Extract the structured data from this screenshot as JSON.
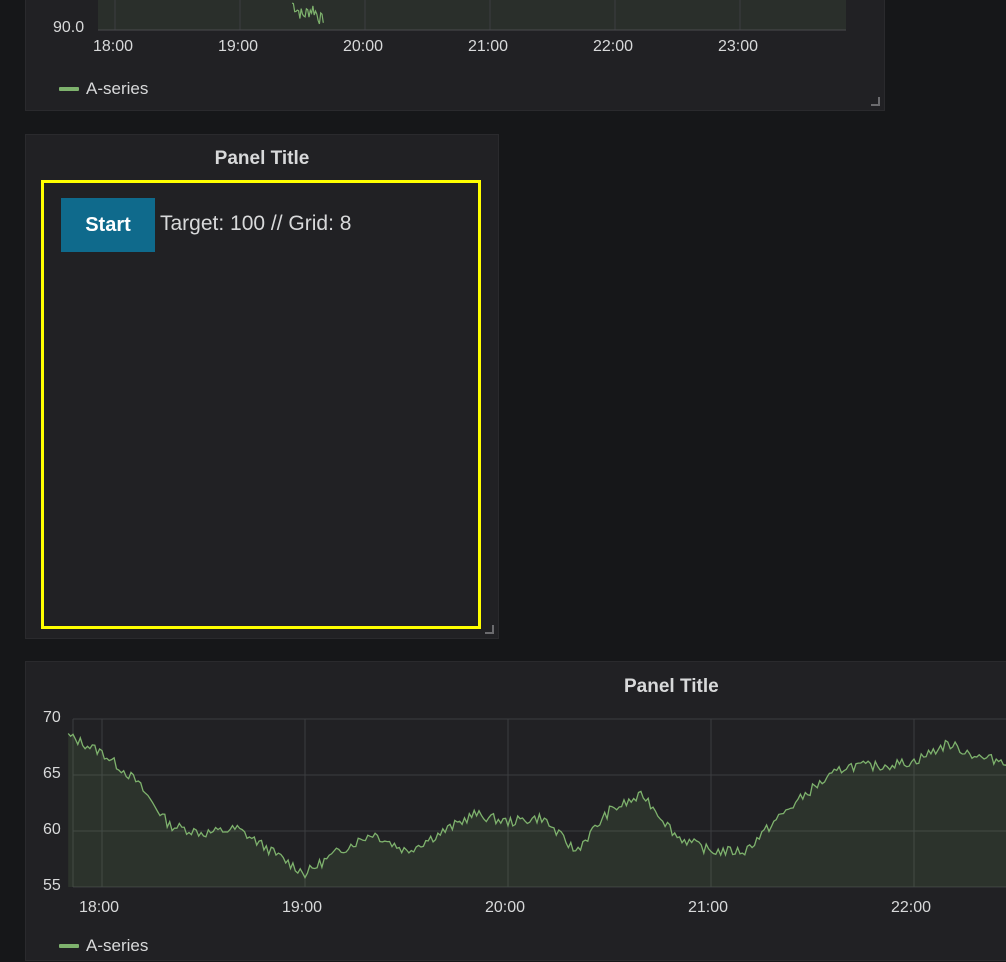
{
  "top_panel": {
    "y_tick": "90.0",
    "x_ticks": [
      "18:00",
      "19:00",
      "20:00",
      "21:00",
      "22:00",
      "23:00"
    ],
    "legend": "A-series"
  },
  "game_panel": {
    "title": "Panel Title",
    "button": "Start",
    "status": "Target: 100 // Grid: 8"
  },
  "bottom_panel": {
    "title": "Panel Title",
    "y_ticks": [
      "70",
      "65",
      "60",
      "55"
    ],
    "x_ticks": [
      "18:00",
      "19:00",
      "20:00",
      "21:00",
      "22:00"
    ],
    "legend": "A-series"
  },
  "colors": {
    "series": "#7eb26d",
    "highlight": "#ffff00",
    "button": "#0f6a8c",
    "background": "#161719",
    "panel": "#212124"
  },
  "chart_data": [
    {
      "type": "area",
      "series": [
        {
          "name": "A-series",
          "x": [
            "19:25",
            "19:30",
            "19:35",
            "19:40"
          ],
          "y": [
            91.5,
            90.8,
            91.2,
            90.4
          ]
        }
      ],
      "xticks": [
        "18:00",
        "19:00",
        "20:00",
        "21:00",
        "22:00",
        "23:00"
      ],
      "yticks": [
        "90.0"
      ],
      "legend": "bottom-left",
      "grid": true
    },
    {
      "type": "area",
      "series": [
        {
          "name": "A-series",
          "x": [
            "17:50",
            "18:00",
            "18:10",
            "18:20",
            "18:30",
            "18:40",
            "18:50",
            "19:00",
            "19:10",
            "19:20",
            "19:30",
            "19:40",
            "19:50",
            "20:00",
            "20:10",
            "20:20",
            "20:30",
            "20:40",
            "20:50",
            "21:00",
            "21:10",
            "21:20",
            "21:30",
            "21:40",
            "21:50",
            "22:00",
            "22:10",
            "22:20",
            "22:30"
          ],
          "y": [
            68.5,
            67,
            64.5,
            60.5,
            59.8,
            60.2,
            58.2,
            56.2,
            58.2,
            59.8,
            58.2,
            59.8,
            61.5,
            60.8,
            61.2,
            58.2,
            61.8,
            63.2,
            59.5,
            58.2,
            58.2,
            61.2,
            63.8,
            65.8,
            65.8,
            66.2,
            67.8,
            66.5,
            66.2
          ]
        }
      ],
      "xticks": [
        "18:00",
        "19:00",
        "20:00",
        "21:00",
        "22:00"
      ],
      "yticks": [
        70,
        65,
        60,
        55
      ],
      "ylim": [
        55,
        70
      ],
      "legend": "bottom-left",
      "grid": true
    }
  ]
}
